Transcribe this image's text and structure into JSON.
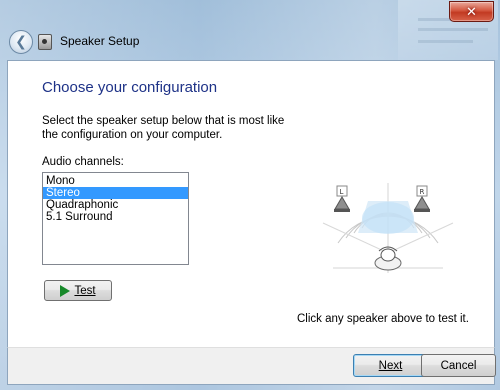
{
  "window": {
    "title": "Speaker Setup",
    "close_glyph": "✕",
    "back_glyph": "❮"
  },
  "main": {
    "heading": "Choose your configuration",
    "description": "Select the speaker setup below that is most like the configuration on your computer.",
    "audio_channels_label": "Audio channels:",
    "channels": [
      "Mono",
      "Stereo",
      "Quadraphonic",
      "5.1 Surround"
    ],
    "selected_channel": "Stereo",
    "test_button_label": "Test",
    "hint": "Click any speaker above to test it."
  },
  "diagram": {
    "left_speaker_label": "L",
    "right_speaker_label": "R"
  },
  "footer": {
    "next_label": "Next",
    "cancel_label": "Cancel"
  },
  "colors": {
    "heading": "#1e3287",
    "selection": "#3399ff",
    "test_icon": "#17892a",
    "close_button": "#c23a22"
  }
}
